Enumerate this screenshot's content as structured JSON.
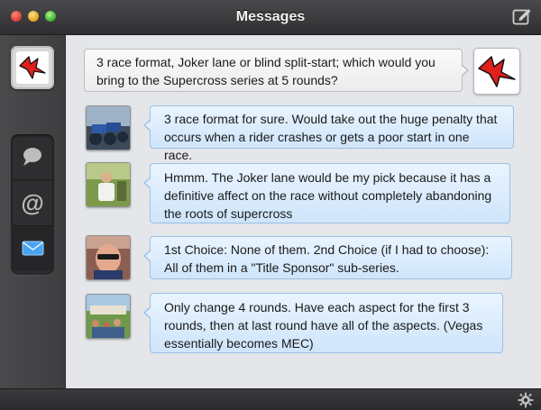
{
  "window": {
    "title": "Messages"
  },
  "sidebar": {
    "items": [
      {
        "name": "chat",
        "icon": "speech-bubble-icon"
      },
      {
        "name": "mentions",
        "icon": "at-icon",
        "glyph": "@"
      },
      {
        "name": "messages",
        "icon": "envelope-icon",
        "selected": true
      }
    ]
  },
  "messages": [
    {
      "sender": "self",
      "text": "3 race format, Joker lane or blind split-start; which would you bring to the Supercross series at 5 rounds?"
    },
    {
      "sender": "reply",
      "avatar": "motorcycles-photo",
      "text": "3 race format for sure. Would take out the huge penalty that occurs when a rider crashes or gets a poor start in one race."
    },
    {
      "sender": "reply",
      "avatar": "man-outdoors-photo",
      "text": "Hmmm. The Joker lane would be my pick because it has a definitive affect on the race without completely abandoning the roots of supercross"
    },
    {
      "sender": "reply",
      "avatar": "man-sunglasses-photo",
      "text": "1st Choice: None of them.  2nd Choice (if I had to choose): All of them in a \"Title Sponsor\" sub-series."
    },
    {
      "sender": "reply",
      "avatar": "crowd-outdoors-photo",
      "text": "Only change 4 rounds. Have each aspect for the first 3 rounds, then at last round have all of the aspects. (Vegas essentially becomes MEC)"
    }
  ],
  "colors": {
    "accent": "#4aa3f0",
    "logo_red": "#e0201c"
  }
}
